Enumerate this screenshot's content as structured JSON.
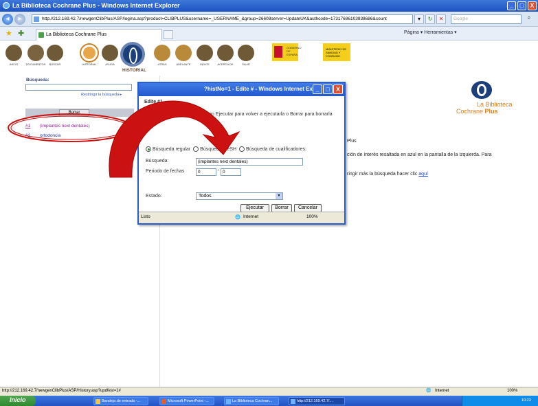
{
  "window": {
    "title": "La Biblioteca Cochrane Plus - Windows Internet Explorer",
    "controls": [
      "_",
      "□",
      "X"
    ]
  },
  "browser": {
    "address": "http://212.169.42.7/newgenClibPlus/ASP/logina.asp?product=CLIBPLUS&username=_USERNAME_&group=26608server=UpdateUK&authcode=17317686103838686&count",
    "search_placeholder": "Google",
    "tab_title": "La Biblioteca Cochrane Plus",
    "command_bar": "Página ▾  Herramientas ▾"
  },
  "site": {
    "nav_labels": [
      "INICIO",
      "DOCUMENTOS",
      "BUSCAR",
      "HISTORIAL",
      "AYUDA",
      "ATRAS",
      "ADELANTE",
      "INDICE",
      "ACERCA DE",
      "SALIR"
    ],
    "section_title": "HISTORIAL",
    "gobierno": "GOBIERNO DE ESPAÑA",
    "ministerio": "MINISTERIO DE SANIDAD Y CONSUMO"
  },
  "left_panel": {
    "search_label": "Búsqueda:",
    "search_value": "",
    "restrict_link": "Restringir la búsqueda ▸",
    "history_button": "Borrar",
    "history": [
      {
        "num": "#1",
        "query": "(implantes next dentales)"
      },
      {
        "num": "#2",
        "query": "ortodoncia"
      }
    ]
  },
  "brand": {
    "line1": "La Biblioteca",
    "line2_a": "Cochrane",
    "line2_b": "Plus"
  },
  "main_text": {
    "line1": "Plus",
    "line2": "ción de interés resaltada en azul en la pantalla de la izquierda. Para",
    "line3_pre": "ringir más la búsqueda hacer clic",
    "line3_link": "aquí"
  },
  "dialog": {
    "title": "?histNo=1 - Edite # - Windows Internet Ex...",
    "heading": "Edite #1",
    "description": "Edite la búsqueda y pulse clic en Ejecutar para volver a ejecutarla o Borrar para borrarla",
    "radios": [
      "Búsqueda regular",
      "Búsqueda MeSH",
      "Búsqueda de cualificadores:"
    ],
    "selected_radio": 0,
    "fields": {
      "busqueda_label": "Búsqueda:",
      "busqueda_value": "(implantes next dentales)",
      "periodo_label": "Periodo de fechas",
      "periodo_from": "0",
      "periodo_to": "0",
      "estado_label": "Estado:",
      "estado_value": "Todos"
    },
    "buttons": {
      "ejecutar": "Ejecutar",
      "borrar": "Borrar",
      "cancelar": "Cancelar"
    },
    "status": {
      "left": "Listo",
      "zone": "Internet",
      "zoom": "100%"
    }
  },
  "statusbar": {
    "url": "http://212.169.42.7/newgenClibPlus/ASP/History.asp?updfest=1#",
    "zone": "Internet",
    "zoom": "100%"
  },
  "taskbar": {
    "start": "Inicio",
    "tasks": [
      "Bandeja de entrada -...",
      "Microsoft PowerPoint -...",
      "La Biblioteca Cochran...",
      "http://212.169.42.7/..."
    ],
    "time": "10:23"
  },
  "colors": {
    "annotation_red": "#cc1111",
    "link_blue": "#2233aa",
    "brand_orange": "#e07d18"
  }
}
